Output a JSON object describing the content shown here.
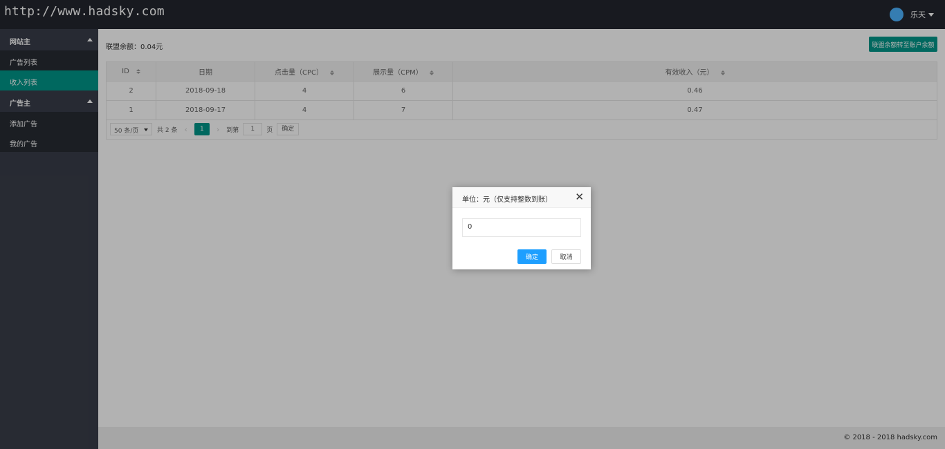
{
  "header": {
    "logo": "http://www.hadsky.com",
    "username": "乐天"
  },
  "sidebar": {
    "groups": [
      {
        "label": "网站主",
        "items": [
          "广告列表",
          "收入列表"
        ]
      },
      {
        "label": "广告主",
        "items": [
          "添加广告",
          "我的广告"
        ]
      }
    ],
    "active_item": "收入列表"
  },
  "main": {
    "balance": "联盟余额：0.04元",
    "transfer_button": "联盟余额转至账户余额",
    "table": {
      "columns": [
        "ID",
        "日期",
        "点击量（CPC）",
        "展示量（CPM）",
        "有效收入（元）"
      ],
      "rows": [
        [
          "2",
          "2018-09-18",
          "4",
          "6",
          "0.46"
        ],
        [
          "1",
          "2018-09-17",
          "4",
          "7",
          "0.47"
        ]
      ]
    },
    "pager": {
      "per_page": "50 条/页",
      "total": "共 2 条",
      "current": "1",
      "goto_label": "到第",
      "goto_value": "1",
      "page_unit": "页",
      "confirm": "确定"
    }
  },
  "footer": {
    "copyright": "© 2018 - 2018 hadsky.com"
  },
  "dialog": {
    "title": "单位：元（仅支持整数到账）",
    "input_value": "0",
    "ok_label": "确定",
    "cancel_label": "取消"
  },
  "colors": {
    "accent": "#009688",
    "primary": "#1e9fff",
    "header_bg": "#23262e",
    "sidebar_bg": "#393d49"
  }
}
